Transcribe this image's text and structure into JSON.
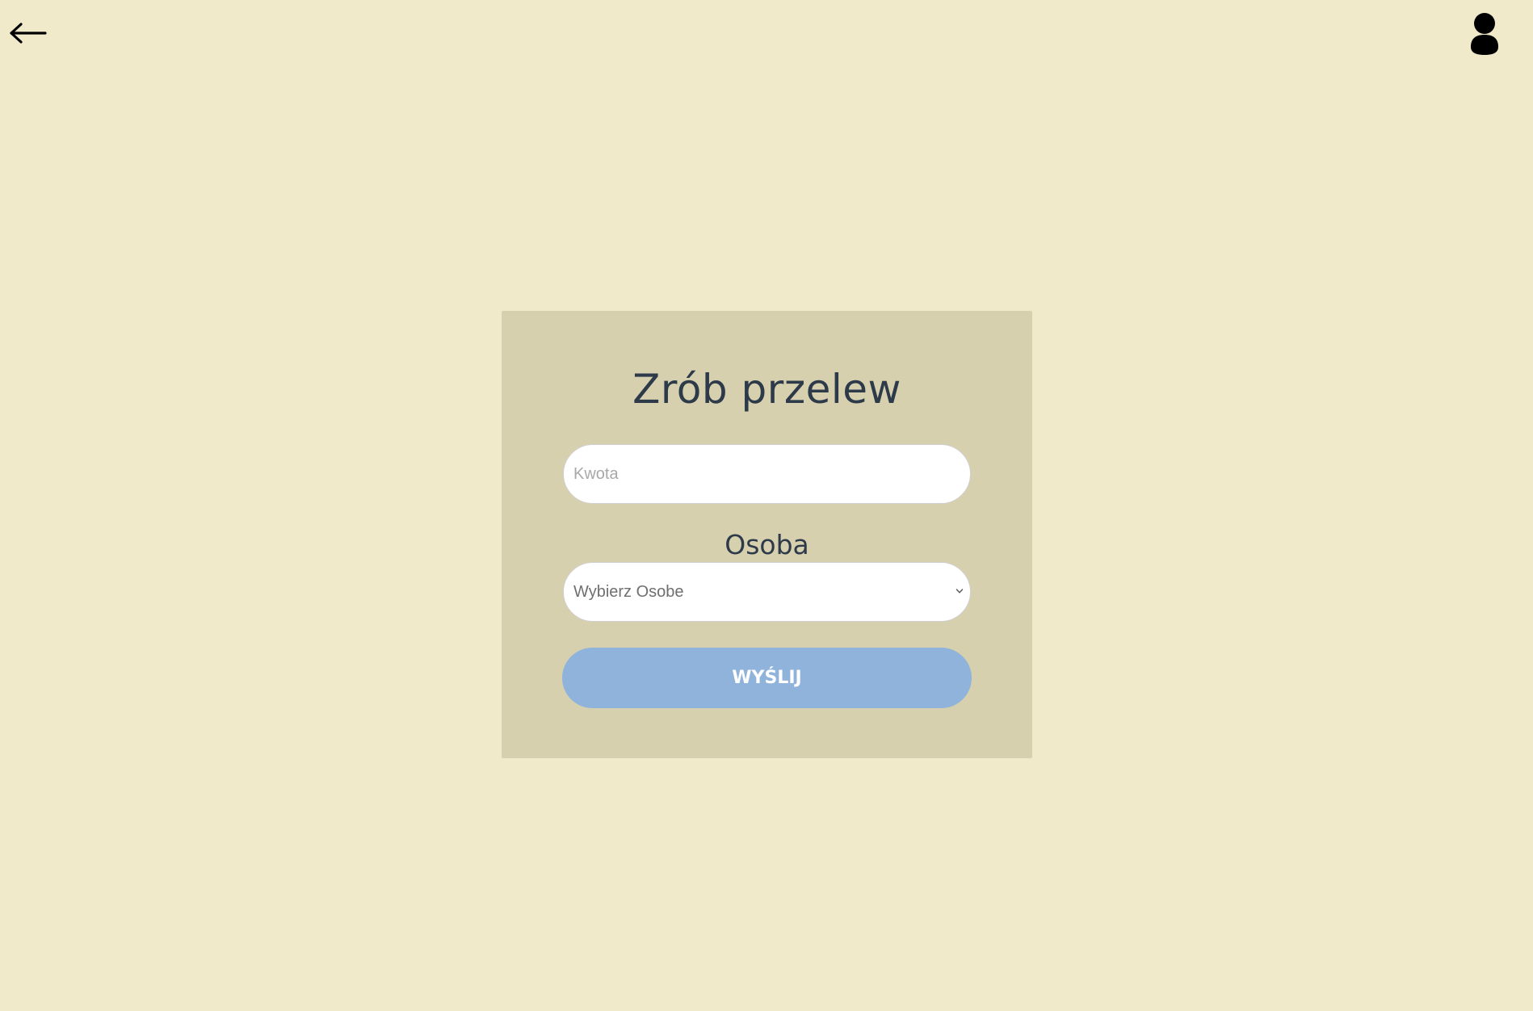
{
  "header": {
    "back_icon": "arrow-left-icon",
    "user_icon": "user-icon"
  },
  "form": {
    "title": "Zrób przelew",
    "amount_placeholder": "Kwota",
    "amount_value": "",
    "person_label": "Osoba",
    "person_selected": "Wybierz Osobe",
    "submit_label": "WYŚLIJ"
  },
  "colors": {
    "page_background": "#f1eaca",
    "card_background": "#d7d0ae",
    "button_background": "#8fb3da",
    "text_dark": "#2d3a4a"
  }
}
